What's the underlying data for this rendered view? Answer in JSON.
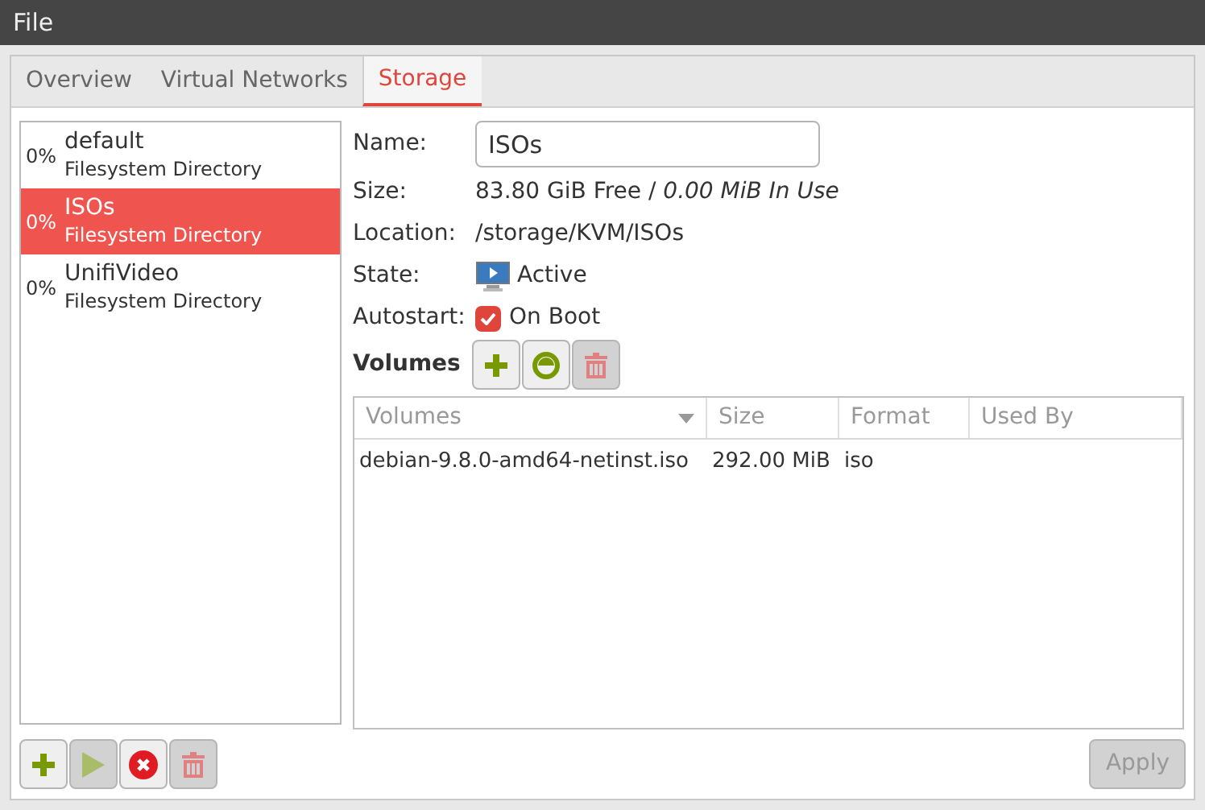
{
  "menu": [
    "File"
  ],
  "tabs": [
    {
      "label": "Overview",
      "selected": false
    },
    {
      "label": "Virtual Networks",
      "selected": false
    },
    {
      "label": "Storage",
      "selected": true
    }
  ],
  "pools": [
    {
      "usage": "0%",
      "name": "default",
      "type": "Filesystem Directory",
      "selected": false
    },
    {
      "usage": "0%",
      "name": "ISOs",
      "type": "Filesystem Directory",
      "selected": true
    },
    {
      "usage": "0%",
      "name": "UnifiVideo",
      "type": "Filesystem Directory",
      "selected": false
    }
  ],
  "details": {
    "name_label": "Name:",
    "name_value": "ISOs",
    "size_label": "Size:",
    "size_free": "83.80 GiB Free / ",
    "size_used": "0.00 MiB In Use",
    "location_label": "Location:",
    "location": "/storage/KVM/ISOs",
    "state_label": "State:",
    "state": "Active",
    "autostart_label": "Autostart:",
    "autostart": {
      "label": "On Boot",
      "checked": true
    }
  },
  "volumes": {
    "label": "Volumes",
    "buttons": [
      {
        "kind": "add",
        "disabled": false
      },
      {
        "kind": "refresh",
        "disabled": false
      },
      {
        "kind": "delete",
        "disabled": true
      }
    ],
    "columns": [
      "Volumes",
      "Size",
      "Format",
      "Used By"
    ],
    "rows": [
      [
        "debian-9.8.0-amd64-netinst.iso",
        "292.00 MiB",
        "iso",
        ""
      ]
    ]
  },
  "pool_buttons": [
    {
      "kind": "add",
      "disabled": false
    },
    {
      "kind": "start",
      "disabled": true
    },
    {
      "kind": "stop",
      "disabled": false
    },
    {
      "kind": "delete",
      "disabled": true
    }
  ],
  "apply": {
    "label": "Apply",
    "disabled": true
  }
}
